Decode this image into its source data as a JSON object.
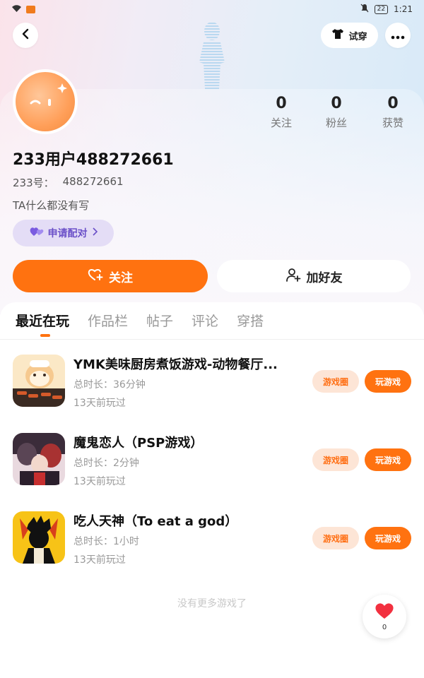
{
  "status_bar": {
    "time": "1:21",
    "battery": "22"
  },
  "header": {
    "tryon_label": "试穿"
  },
  "profile": {
    "stats": [
      {
        "value": "0",
        "label": "关注"
      },
      {
        "value": "0",
        "label": "粉丝"
      },
      {
        "value": "0",
        "label": "获赞"
      }
    ],
    "username": "233用户488272661",
    "id_label": "233号：",
    "id_value": "488272661",
    "bio": "TA什么都没有写",
    "match_label": "申请配对"
  },
  "actions": {
    "follow_label": "关注",
    "add_friend_label": "加好友"
  },
  "tabs": [
    {
      "label": "最近在玩",
      "active": true
    },
    {
      "label": "作品栏",
      "active": false
    },
    {
      "label": "帖子",
      "active": false
    },
    {
      "label": "评论",
      "active": false
    },
    {
      "label": "穿搭",
      "active": false
    }
  ],
  "games": [
    {
      "title": "YMK美味厨房煮饭游戏-动物餐厅...",
      "duration": "总时长：36分钟",
      "last_played": "13天前玩过",
      "circle_label": "游戏圈",
      "play_label": "玩游戏"
    },
    {
      "title": "魔鬼恋人（PSP游戏）",
      "duration": "总时长：2分钟",
      "last_played": "13天前玩过",
      "circle_label": "游戏圈",
      "play_label": "玩游戏"
    },
    {
      "title": "吃人天神（To eat a god）",
      "duration": "总时长：1小时",
      "last_played": "13天前玩过",
      "circle_label": "游戏圈",
      "play_label": "玩游戏"
    }
  ],
  "footer": {
    "no_more": "没有更多游戏了",
    "like_count": "0"
  },
  "colors": {
    "accent": "#ff7210",
    "match_bg": "#e4ddf6",
    "match_text": "#6a4fc8"
  }
}
